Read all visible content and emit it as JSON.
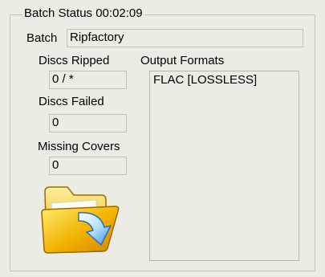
{
  "group": {
    "title": "Batch Status 00:02:09"
  },
  "batch": {
    "label": "Batch",
    "value": "Ripfactory"
  },
  "discs_ripped": {
    "label": "Discs Ripped",
    "value": "0 / *"
  },
  "discs_failed": {
    "label": "Discs Failed",
    "value": "0"
  },
  "missing_covers": {
    "label": "Missing Covers",
    "value": "0"
  },
  "output_formats": {
    "label": "Output Formats",
    "items": [
      "FLAC [LOSSLESS]"
    ]
  },
  "icons": {
    "output_folder": "open-folder-icon"
  }
}
